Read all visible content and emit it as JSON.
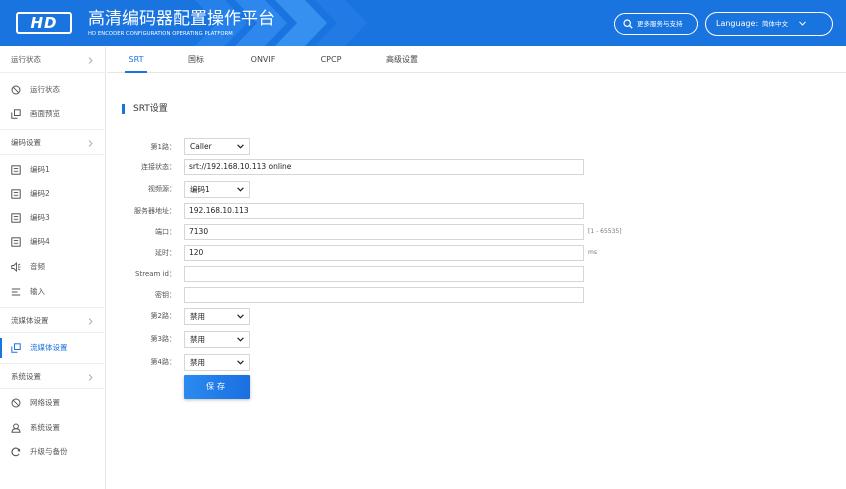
{
  "header": {
    "logo": "HD",
    "title": "高清编码器配置操作平台",
    "subtitle": "HD ENCODER CONFIGURATION OPERATING PLATFORM",
    "support_label": "更多服务与支持",
    "language_label": "Language:",
    "language_value": "简体中文",
    "brand_color": "#1a74e0"
  },
  "sidebar": {
    "groups": [
      {
        "label": "运行状态",
        "items": [
          {
            "label": "运行状态",
            "icon": "clock-icon"
          },
          {
            "label": "画面预览",
            "icon": "copy-icon"
          }
        ]
      },
      {
        "label": "编码设置",
        "items": [
          {
            "label": "编码1",
            "icon": "list-icon"
          },
          {
            "label": "编码2",
            "icon": "list-icon"
          },
          {
            "label": "编码3",
            "icon": "list-icon"
          },
          {
            "label": "编码4",
            "icon": "list-icon"
          },
          {
            "label": "音频",
            "icon": "speaker-icon"
          },
          {
            "label": "输入",
            "icon": "input-icon"
          }
        ]
      },
      {
        "label": "流媒体设置",
        "items": [
          {
            "label": "流媒体设置",
            "icon": "copy-icon",
            "active": true
          }
        ]
      },
      {
        "label": "系统设置",
        "items": [
          {
            "label": "网络设置",
            "icon": "clock-icon"
          },
          {
            "label": "系统设置",
            "icon": "user-icon"
          },
          {
            "label": "升级与备份",
            "icon": "refresh-icon"
          }
        ]
      }
    ]
  },
  "tabs": [
    {
      "label": "SRT",
      "active": true
    },
    {
      "label": "国标"
    },
    {
      "label": "ONVIF"
    },
    {
      "label": "CPCP"
    },
    {
      "label": "高级设置"
    }
  ],
  "section_title": "SRT设置",
  "form": {
    "mode1": {
      "label": "第1路：",
      "value": "Caller"
    },
    "status": {
      "label": "连接状态：",
      "value": "srt://192.168.10.113 online"
    },
    "source": {
      "label": "视频源：",
      "value": "编码1"
    },
    "server": {
      "label": "服务器地址：",
      "value": "192.168.10.113"
    },
    "port": {
      "label": "端口：",
      "value": "7130",
      "hint": "[1 - 65535]"
    },
    "latency": {
      "label": "延时：",
      "value": "120",
      "hint": "ms"
    },
    "stream_id": {
      "label": "Stream id：",
      "value": ""
    },
    "password": {
      "label": "密钥：",
      "value": ""
    },
    "mode2": {
      "label": "第2路：",
      "value": "禁用"
    },
    "mode3": {
      "label": "第3路：",
      "value": "禁用"
    },
    "mode4": {
      "label": "第4路：",
      "value": "禁用"
    },
    "save_label": "保存"
  }
}
